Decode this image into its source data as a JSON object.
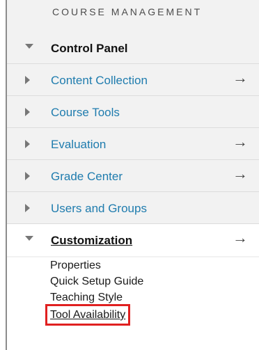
{
  "section_title": "COURSE MANAGEMENT",
  "control_panel": {
    "label": "Control Panel",
    "items": [
      {
        "label": "Content Collection",
        "has_arrow": true,
        "arrow": "→"
      },
      {
        "label": "Course Tools",
        "has_arrow": false,
        "arrow": ""
      },
      {
        "label": "Evaluation",
        "has_arrow": true,
        "arrow": "→"
      },
      {
        "label": "Grade Center",
        "has_arrow": true,
        "arrow": "→"
      },
      {
        "label": "Users and Groups",
        "has_arrow": false,
        "arrow": ""
      }
    ]
  },
  "customization": {
    "label": "Customization",
    "arrow": "→",
    "links": [
      {
        "label": "Properties"
      },
      {
        "label": "Quick Setup Guide"
      },
      {
        "label": "Teaching Style"
      },
      {
        "label": "Tool Availability",
        "highlighted": true
      }
    ]
  },
  "colors": {
    "link_blue": "#1f7cae",
    "highlight_red": "#e02020",
    "panel_gray": "#f2f2f2"
  },
  "icons": {
    "collapsed": "triangle-right-icon",
    "expanded": "triangle-down-icon",
    "arrow": "right-arrow-icon"
  }
}
